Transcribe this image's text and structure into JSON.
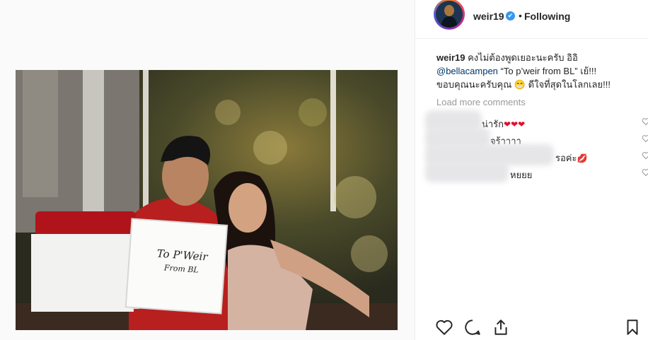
{
  "post": {
    "username": "weir19",
    "verified_icon": "✔",
    "separator": "•",
    "follow_status": "Following",
    "caption": {
      "user": "weir19",
      "line1": "คงไม่ต้องพูดเยอะนะครับ อิอิ",
      "mention": "@bellacampen",
      "line2": "“To p’weir from BL” เย้!!!",
      "line3": "ขอบคุณนะครับคุณ 😁 ดีใจที่สุดในโลกเลย!!!"
    },
    "load_more": "Load more comments",
    "comments": [
      {
        "text": "น่ารัก",
        "hearts": "❤❤❤"
      },
      {
        "text": "จร้าาาา",
        "hearts": ""
      },
      {
        "text": "รอค่ะ",
        "hearts": "💋"
      },
      {
        "text": "หยยย",
        "hearts": ""
      }
    ],
    "photo": {
      "gift_box_text_1": "To P'Weir",
      "gift_box_text_2": "From BL"
    }
  },
  "icons": [
    "heart-icon",
    "comment-icon",
    "share-icon",
    "bookmark-icon"
  ],
  "colors": {
    "link": "#003569",
    "verified": "#3897f0",
    "muted": "#999999",
    "heart": "#e0112b"
  }
}
